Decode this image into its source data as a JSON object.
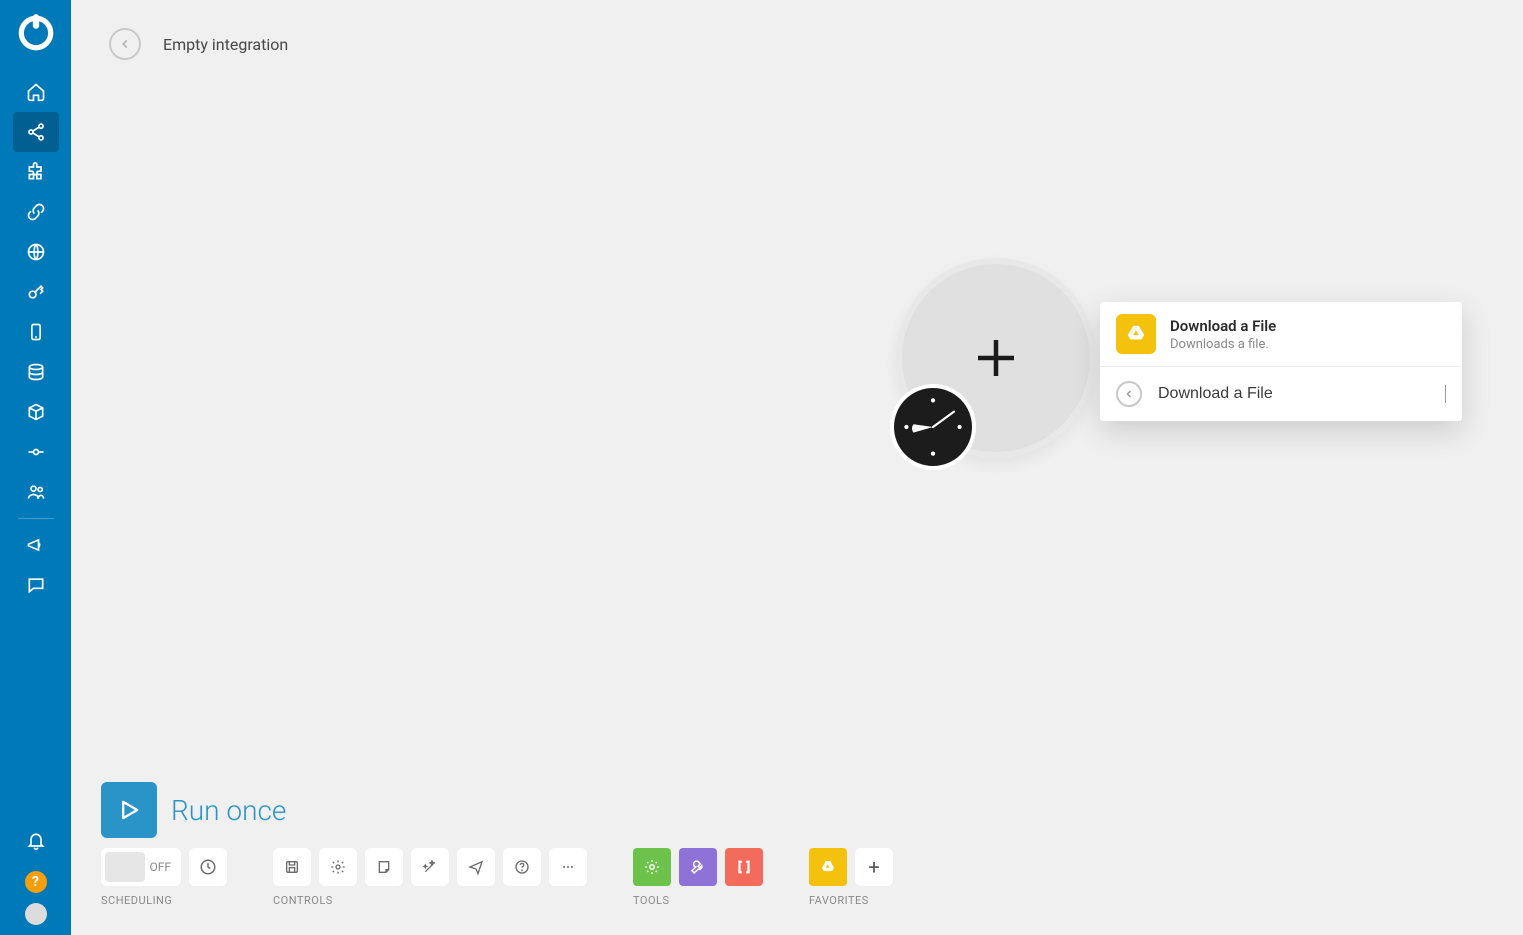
{
  "header": {
    "title": "Empty integration"
  },
  "popover": {
    "item": {
      "title": "Download a File",
      "desc": "Downloads a file."
    },
    "search_value": "Download a File"
  },
  "run": {
    "label": "Run once"
  },
  "groups": {
    "scheduling": "SCHEDULING",
    "controls": "CONTROLS",
    "tools": "TOOLS",
    "favorites": "FAVORITES"
  },
  "switch": {
    "off_label": "OFF"
  }
}
